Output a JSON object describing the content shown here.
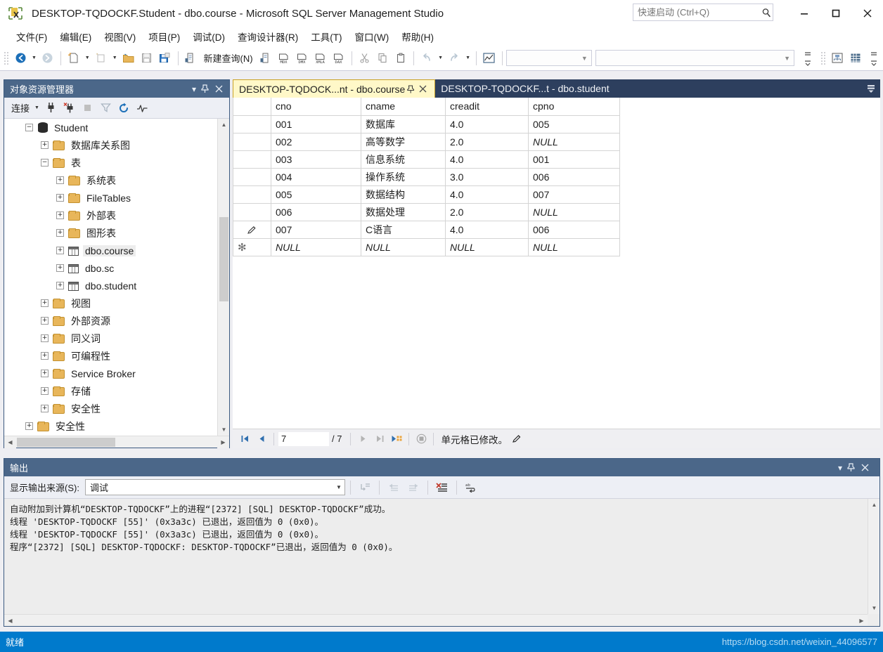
{
  "window": {
    "title": "DESKTOP-TQDOCKF.Student - dbo.course - Microsoft SQL Server Management Studio",
    "app_icon": "ssms-icon",
    "minimize_label": "—",
    "maximize_label": "□",
    "close_label": "✕"
  },
  "quick_launch": {
    "placeholder": "快速启动 (Ctrl+Q)",
    "value": "",
    "icon": "search-icon"
  },
  "menu": {
    "items": [
      {
        "label": "文件(F)"
      },
      {
        "label": "编辑(E)"
      },
      {
        "label": "视图(V)"
      },
      {
        "label": "项目(P)"
      },
      {
        "label": "调试(D)"
      },
      {
        "label": "查询设计器(R)"
      },
      {
        "label": "工具(T)"
      },
      {
        "label": "窗口(W)"
      },
      {
        "label": "帮助(H)"
      }
    ]
  },
  "toolbar": {
    "new_query_label": "新建查询(N)",
    "buttons": [
      {
        "name": "navigate-back-icon"
      },
      {
        "name": "navigate-forward-icon"
      },
      {
        "name": "new-file-icon"
      },
      {
        "name": "new-project-icon"
      },
      {
        "name": "open-folder-icon"
      },
      {
        "name": "save-icon"
      },
      {
        "name": "save-all-icon"
      },
      {
        "name": "new-query-icon"
      },
      {
        "name": "new-database-engine-query-icon"
      },
      {
        "name": "new-mdx-query-icon",
        "label": "MDX"
      },
      {
        "name": "new-dmx-query-icon",
        "label": "DMX"
      },
      {
        "name": "new-xmla-query-icon",
        "label": "XMLA"
      },
      {
        "name": "new-dax-query-icon",
        "label": "DAX"
      },
      {
        "name": "cut-icon"
      },
      {
        "name": "copy-icon"
      },
      {
        "name": "paste-icon"
      },
      {
        "name": "undo-icon"
      },
      {
        "name": "redo-icon"
      },
      {
        "name": "show-diagram-pane-icon"
      },
      {
        "name": "object-explorer-details-icon"
      },
      {
        "name": "properties-window-icon"
      }
    ]
  },
  "object_explorer": {
    "title": "对象资源管理器",
    "connect_label": "连接",
    "toolbar_icons": [
      "connect-icon",
      "disconnect-icon",
      "stop-icon",
      "filter-icon",
      "refresh-icon",
      "activity-monitor-icon"
    ],
    "header_buttons": [
      "dropdown-icon",
      "pin-icon",
      "close-icon"
    ],
    "tree": [
      {
        "label": "Student",
        "indent": 1,
        "icon": "database-icon",
        "state": "expanded",
        "selected": false
      },
      {
        "label": "数据库关系图",
        "indent": 2,
        "icon": "folder-icon",
        "state": "collapsed",
        "selected": false
      },
      {
        "label": "表",
        "indent": 2,
        "icon": "folder-icon",
        "state": "expanded",
        "selected": false
      },
      {
        "label": "系统表",
        "indent": 3,
        "icon": "folder-icon",
        "state": "collapsed",
        "selected": false
      },
      {
        "label": "FileTables",
        "indent": 3,
        "icon": "folder-icon",
        "state": "collapsed",
        "selected": false
      },
      {
        "label": "外部表",
        "indent": 3,
        "icon": "folder-icon",
        "state": "collapsed",
        "selected": false
      },
      {
        "label": "图形表",
        "indent": 3,
        "icon": "folder-icon",
        "state": "collapsed",
        "selected": false
      },
      {
        "label": "dbo.course",
        "indent": 3,
        "icon": "table-icon",
        "state": "collapsed",
        "selected": true
      },
      {
        "label": "dbo.sc",
        "indent": 3,
        "icon": "table-icon",
        "state": "collapsed",
        "selected": false
      },
      {
        "label": "dbo.student",
        "indent": 3,
        "icon": "table-icon",
        "state": "collapsed",
        "selected": false
      },
      {
        "label": "视图",
        "indent": 2,
        "icon": "folder-icon",
        "state": "collapsed",
        "selected": false
      },
      {
        "label": "外部资源",
        "indent": 2,
        "icon": "folder-icon",
        "state": "collapsed",
        "selected": false
      },
      {
        "label": "同义词",
        "indent": 2,
        "icon": "folder-icon",
        "state": "collapsed",
        "selected": false
      },
      {
        "label": "可编程性",
        "indent": 2,
        "icon": "folder-icon",
        "state": "collapsed",
        "selected": false
      },
      {
        "label": "Service Broker",
        "indent": 2,
        "icon": "folder-icon",
        "state": "collapsed",
        "selected": false
      },
      {
        "label": "存储",
        "indent": 2,
        "icon": "folder-icon",
        "state": "collapsed",
        "selected": false
      },
      {
        "label": "安全性",
        "indent": 2,
        "icon": "folder-icon",
        "state": "collapsed",
        "selected": false
      },
      {
        "label": "安全性",
        "indent": 1,
        "icon": "folder-icon",
        "state": "collapsed",
        "selected": false
      }
    ]
  },
  "document_tabs": {
    "tabs": [
      {
        "label": "DESKTOP-TQDOCK...nt - dbo.course",
        "active": true
      },
      {
        "label": "DESKTOP-TQDOCKF...t - dbo.student",
        "active": false
      }
    ],
    "pin_icon": "pin-icon",
    "close_icon": "close-icon",
    "overflow_icon": "tab-overflow-icon"
  },
  "grid": {
    "columns": [
      "cno",
      "cname",
      "creadit",
      "cpno"
    ],
    "rows": [
      {
        "marker": "",
        "cells": [
          "001",
          "数据库",
          "4.0",
          "005"
        ]
      },
      {
        "marker": "",
        "cells": [
          "002",
          "高等数学",
          "2.0",
          "NULL"
        ]
      },
      {
        "marker": "",
        "cells": [
          "003",
          "信息系统",
          "4.0",
          "001"
        ]
      },
      {
        "marker": "",
        "cells": [
          "004",
          "操作系统",
          "3.0",
          "006"
        ]
      },
      {
        "marker": "",
        "cells": [
          "005",
          "数据结构",
          "4.0",
          "007"
        ]
      },
      {
        "marker": "",
        "cells": [
          "006",
          "数据处理",
          "2.0",
          "NULL"
        ]
      },
      {
        "marker": "edit-pencil-icon",
        "cells": [
          "007",
          "C语言",
          "4.0",
          "006"
        ]
      },
      {
        "marker": "new-row-asterisk-icon",
        "cells": [
          "NULL",
          "NULL",
          "NULL",
          "NULL"
        ]
      }
    ]
  },
  "grid_nav": {
    "current_row": "7",
    "total_label": "/ 7",
    "status": "单元格已修改。",
    "buttons": [
      "first-row-icon",
      "previous-row-icon",
      "next-row-icon",
      "last-row-icon",
      "new-row-icon",
      "stop-icon",
      "edit-pencil-icon"
    ]
  },
  "output": {
    "title": "输出",
    "source_label": "显示输出来源(S):",
    "source_value": "调试",
    "header_buttons": [
      "dropdown-icon",
      "pin-icon",
      "close-icon"
    ],
    "toolbar_icons": [
      "go-to-source-icon",
      "find-previous-icon",
      "find-next-icon",
      "clear-all-icon",
      "toggle-word-wrap-icon"
    ],
    "lines": [
      "自动附加到计算机“DESKTOP-TQDOCKF”上的进程“[2372] [SQL] DESKTOP-TQDOCKF”成功。",
      "线程 'DESKTOP-TQDOCKF [55]' (0x3a3c) 已退出，返回值为 0 (0x0)。",
      "线程 'DESKTOP-TQDOCKF [55]' (0x3a3c) 已退出，返回值为 0 (0x0)。",
      "程序“[2372] [SQL] DESKTOP-TQDOCKF: DESKTOP-TQDOCKF”已退出，返回值为 0 (0x0)。"
    ]
  },
  "status_bar": {
    "text": "就绪",
    "watermark": "https://blog.csdn.net/weixin_44096577",
    "color": "#007ACC"
  }
}
